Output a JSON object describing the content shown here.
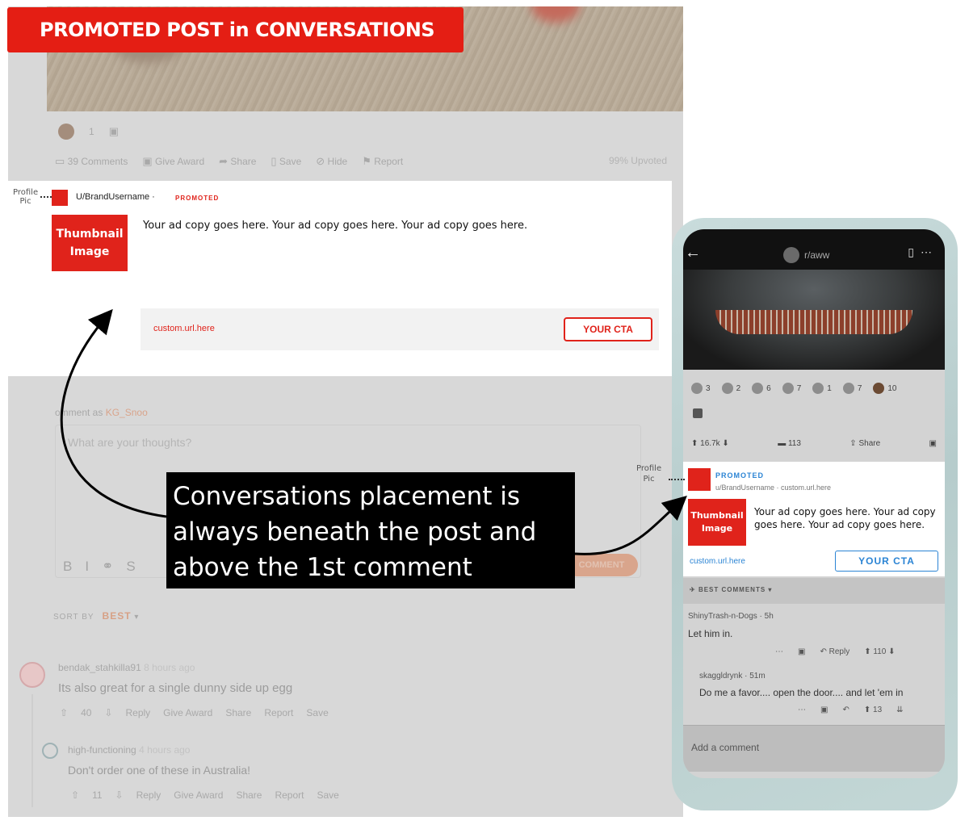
{
  "banner": "PROMOTED POST in CONVERSATIONS",
  "desktop": {
    "award_count": "1",
    "actions": [
      "39 Comments",
      "Give Award",
      "Share",
      "Save",
      "Hide",
      "Report"
    ],
    "upvoted": "99% Upvoted",
    "promo": {
      "profile_label_1": "Profile",
      "profile_label_2": "Pic",
      "username": "U/BrandUsername",
      "sep": "·",
      "tag": "PROMOTED",
      "thumb_line1": "Thumbnail",
      "thumb_line2": "Image",
      "ad_copy": "Your ad copy goes here. Your ad copy goes here. Your ad copy goes here.",
      "url": "custom.url.here",
      "cta": "YOUR CTA"
    },
    "comment_as": "omment as",
    "comment_user": "KG_Snoo",
    "comment_placeholder": "What are your thoughts?",
    "comment_button": "COMMENT",
    "format_icons": [
      "B",
      "I",
      "⚭",
      "S"
    ],
    "sort_label": "SORT BY",
    "sort_value": "BEST",
    "comments": [
      {
        "user": "bendak_stahkilla91",
        "time": "8 hours ago",
        "text": "Its also great for a single dunny side up egg",
        "votes": "40",
        "actions": [
          "Reply",
          "Give Award",
          "Share",
          "Report",
          "Save"
        ]
      },
      {
        "user": "high-functioning",
        "time": "4 hours ago",
        "text": "Don't order one of these in Australia!",
        "votes": "11",
        "actions": [
          "Reply",
          "Give Award",
          "Share",
          "Report",
          "Save"
        ]
      }
    ]
  },
  "caption": {
    "line1": "Conversations placement is",
    "line2": "always beneath the post and",
    "line3": "above the 1st comment"
  },
  "phone": {
    "subreddit": "r/aww",
    "awards": [
      "3",
      "2",
      "6",
      "7",
      "1",
      "7",
      "10"
    ],
    "upvotes": "16.7k",
    "comments": "113",
    "share": "Share",
    "profile_label_1": "Profile",
    "profile_label_2": "Pic",
    "promo": {
      "tag": "PROMOTED",
      "user_line": "u/BrandUsername · custom.url.here",
      "thumb_line1": "Thumbnail",
      "thumb_line2": "Image",
      "ad_copy": "Your ad copy goes here. Your ad copy goes here. Your ad copy goes here.",
      "url": "custom.url.here",
      "cta": "YOUR CTA"
    },
    "best_comments": "BEST COMMENTS ▾",
    "c1_meta": "ShinyTrash-n-Dogs · 5h",
    "c1_text": "Let him in.",
    "c1_reply": "Reply",
    "c1_votes": "110",
    "c2_meta": "skaggldrynk · 51m",
    "c2_text": "Do me a favor.... open the door.... and let 'em in",
    "c2_votes": "13",
    "add_comment": "Add a comment"
  }
}
